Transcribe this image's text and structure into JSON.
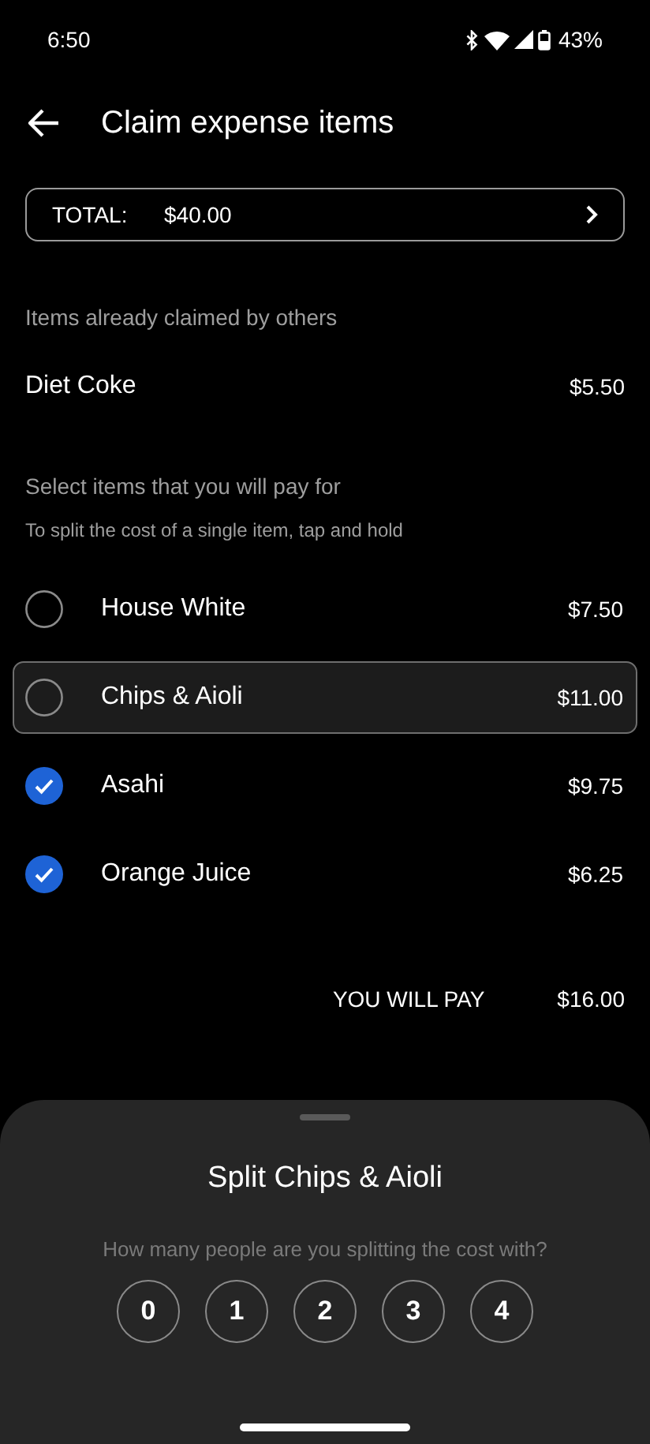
{
  "status_bar": {
    "time": "6:50",
    "battery": "43%"
  },
  "header": {
    "title": "Claim expense items"
  },
  "total": {
    "label": "TOTAL:",
    "amount": "$40.00"
  },
  "claimed_section": {
    "heading": "Items already claimed by others",
    "items": [
      {
        "name": "Diet Coke",
        "price": "$5.50"
      }
    ]
  },
  "select_section": {
    "heading": "Select items that you will pay for",
    "hint": "To split the cost of a single item, tap and hold",
    "items": [
      {
        "name": "House White",
        "price": "$7.50",
        "checked": false,
        "selected": false
      },
      {
        "name": "Chips & Aioli",
        "price": "$11.00",
        "checked": false,
        "selected": true
      },
      {
        "name": "Asahi",
        "price": "$9.75",
        "checked": true,
        "selected": false
      },
      {
        "name": "Orange Juice",
        "price": "$6.25",
        "checked": true,
        "selected": false
      }
    ]
  },
  "summary": {
    "label": "YOU WILL PAY",
    "amount": "$16.00"
  },
  "bottom_sheet": {
    "title": "Split Chips & Aioli",
    "question": "How many people are you splitting the cost with?",
    "options": [
      "0",
      "1",
      "2",
      "3",
      "4"
    ]
  }
}
